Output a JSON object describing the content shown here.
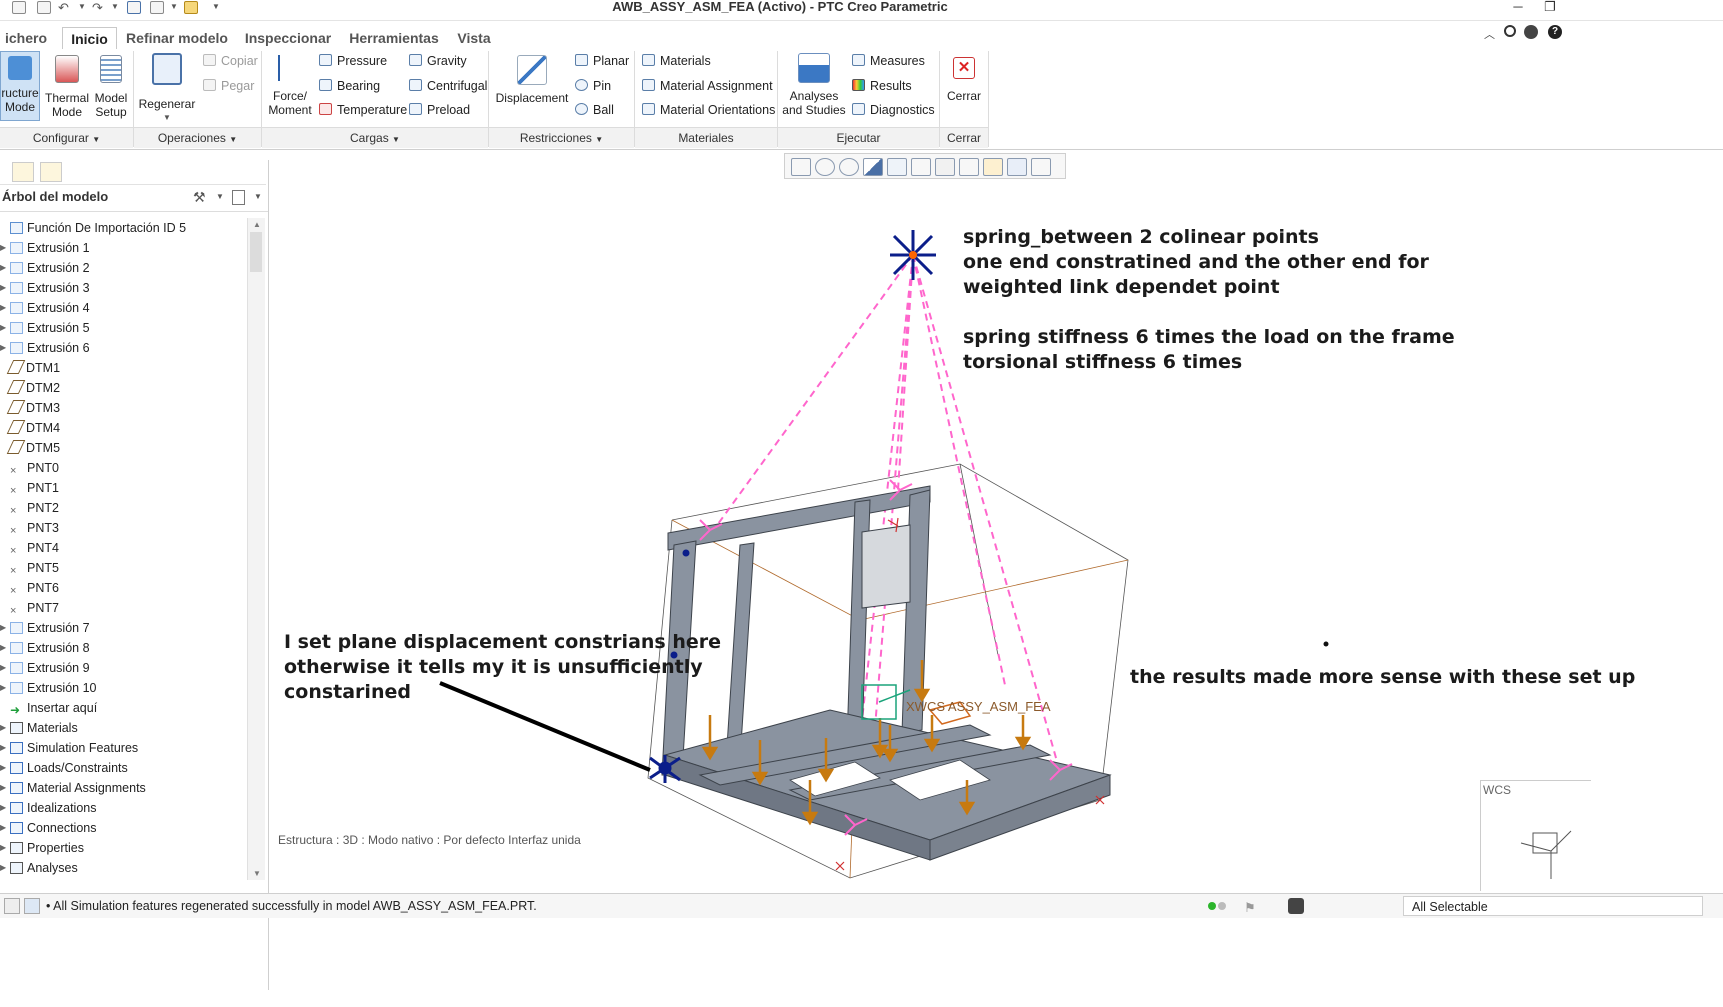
{
  "window": {
    "title": "AWB_ASSY_ASM_FEA (Activo) - PTC Creo Parametric"
  },
  "tabs": [
    {
      "label": "ichero",
      "has_dropdown": true
    },
    {
      "label": "Inicio",
      "active": true
    },
    {
      "label": "Refinar modelo"
    },
    {
      "label": "Inspeccionar"
    },
    {
      "label": "Herramientas"
    },
    {
      "label": "Vista"
    }
  ],
  "ribbon": {
    "configurar": {
      "structure_mode": "ructure\nMode",
      "thermal_mode": "Thermal\nMode",
      "model_setup": "Model\nSetup",
      "group_label": "Configurar"
    },
    "operaciones": {
      "regenerar": "Regenerar",
      "copiar": "Copiar",
      "pegar": "Pegar",
      "group_label": "Operaciones"
    },
    "cargas": {
      "force_moment": "Force/\nMoment",
      "pressure": "Pressure",
      "bearing": "Bearing",
      "temperature": "Temperature",
      "gravity": "Gravity",
      "centrifugal": "Centrifugal",
      "preload": "Preload",
      "group_label": "Cargas"
    },
    "restricciones": {
      "displacement": "Displacement",
      "planar": "Planar",
      "pin": "Pin",
      "ball": "Ball",
      "group_label": "Restricciones"
    },
    "materiales": {
      "materials": "Materials",
      "material_assignment": "Material Assignment",
      "material_orientations": "Material Orientations",
      "group_label": "Materiales"
    },
    "ejecutar": {
      "analyses_and_studies": "Analyses\nand Studies",
      "measures": "Measures",
      "results": "Results",
      "diagnostics": "Diagnostics",
      "group_label": "Ejecutar"
    },
    "cerrar": {
      "cerrar": "Cerrar",
      "group_label": "Cerrar"
    }
  },
  "model_tree": {
    "title": "Árbol del modelo",
    "items": [
      {
        "label": "Función De Importación ID 5",
        "icon": "import-feature-icon"
      },
      {
        "label": "Extrusión 1",
        "icon": "extrude-icon"
      },
      {
        "label": "Extrusión 2",
        "icon": "extrude-icon"
      },
      {
        "label": "Extrusión 3",
        "icon": "extrude-icon"
      },
      {
        "label": "Extrusión 4",
        "icon": "extrude-icon"
      },
      {
        "label": "Extrusión 5",
        "icon": "extrude-icon"
      },
      {
        "label": "Extrusión 6",
        "icon": "extrude-icon"
      },
      {
        "label": "DTM1",
        "icon": "datum-plane-icon"
      },
      {
        "label": "DTM2",
        "icon": "datum-plane-icon"
      },
      {
        "label": "DTM3",
        "icon": "datum-plane-icon"
      },
      {
        "label": "DTM4",
        "icon": "datum-plane-icon"
      },
      {
        "label": "DTM5",
        "icon": "datum-plane-icon"
      },
      {
        "label": "PNT0",
        "icon": "datum-point-icon"
      },
      {
        "label": "PNT1",
        "icon": "datum-point-icon"
      },
      {
        "label": "PNT2",
        "icon": "datum-point-icon"
      },
      {
        "label": "PNT3",
        "icon": "datum-point-icon"
      },
      {
        "label": "PNT4",
        "icon": "datum-point-icon"
      },
      {
        "label": "PNT5",
        "icon": "datum-point-icon"
      },
      {
        "label": "PNT6",
        "icon": "datum-point-icon"
      },
      {
        "label": "PNT7",
        "icon": "datum-point-icon"
      },
      {
        "label": "Extrusión 7",
        "icon": "extrude-icon"
      },
      {
        "label": "Extrusión 8",
        "icon": "extrude-icon"
      },
      {
        "label": "Extrusión 9",
        "icon": "extrude-icon"
      },
      {
        "label": "Extrusión 10",
        "icon": "extrude-icon"
      },
      {
        "label": "Insertar aquí",
        "icon": "insert-arrow-icon"
      },
      {
        "label": "Materials",
        "icon": "materials-icon"
      },
      {
        "label": "Simulation Features",
        "icon": "simulation-icon"
      },
      {
        "label": "Loads/Constraints",
        "icon": "loads-icon"
      },
      {
        "label": "Material Assignments",
        "icon": "material-assignment-icon"
      },
      {
        "label": "Idealizations",
        "icon": "idealization-icon"
      },
      {
        "label": "Connections",
        "icon": "connections-icon"
      },
      {
        "label": "Properties",
        "icon": "properties-icon"
      },
      {
        "label": "Analyses",
        "icon": "analyses-icon"
      }
    ]
  },
  "viewport": {
    "annotation_top": [
      "spring_between 2 colinear points",
      "one end constratined and the other end for",
      "weighted link dependet point",
      "",
      "spring stiffness 6 times the load on the frame",
      "torsional stiffness 6 times"
    ],
    "annotation_left": [
      "I set plane displacement constrians here",
      "otherwise it tells my it is unsufficiently",
      "constarined"
    ],
    "annotation_right": "the results made more sense with these set up",
    "model_label": "XWCS ASSY_ASM_FEA",
    "wcs_label": "WCS",
    "status_text": "Estructura : 3D : Modo nativo : Por defecto Interfaz unida"
  },
  "status_bar": {
    "message": "All Simulation features regenerated successfully in model AWB_ASSY_ASM_FEA.PRT.",
    "filter": "All Selectable"
  },
  "colors": {
    "accent_blue": "#2a5ea8",
    "spring_pink": "#ff66cc",
    "frame_gray": "#8a93a0",
    "load_orange": "#c77a10",
    "constraint_navy": "#0b1e8a"
  }
}
